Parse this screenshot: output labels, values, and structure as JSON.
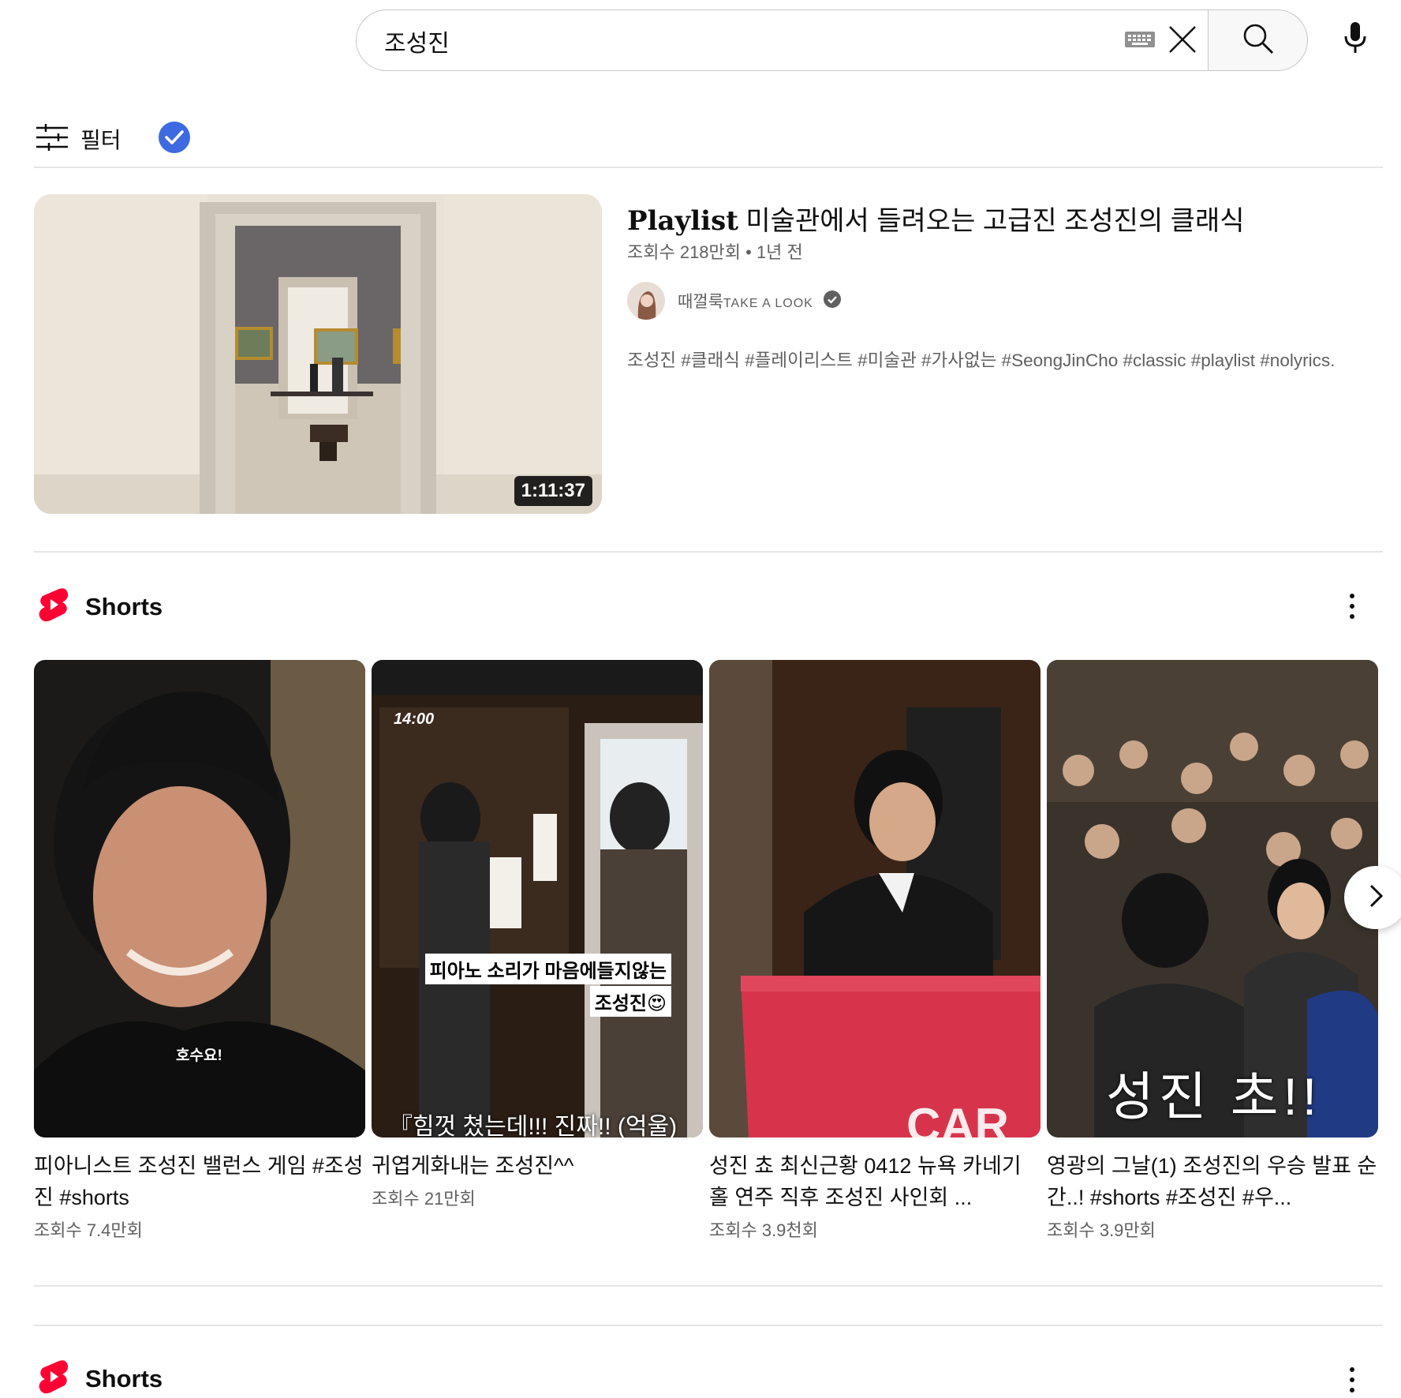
{
  "search": {
    "query": "조성진"
  },
  "filter": {
    "label": "필터"
  },
  "playlist": {
    "title_prefix": "Playlist",
    "title_rest": "미술관에서 들려오는 고급진 조성진의 클래식",
    "meta": "조회수 218만회 • 1년 전",
    "channel_name_main": "때껄룩",
    "channel_name_caps": "TAKE A LOOK",
    "description": "조성진 #클래식 #플레이리스트 #미술관 #가사없는 #SeongJinCho #classic #playlist #nolyrics.",
    "duration": "1:11:37"
  },
  "shorts_section": {
    "title": "Shorts",
    "items": [
      {
        "title": "피아니스트 조성진 밸런스 게임 #조성진 #shorts",
        "views": "조회수 7.4만회",
        "overlay": "호수요!"
      },
      {
        "title": "귀엽게화내는 조성진^^",
        "views": "조회수 21만회",
        "overlay_line1": "피아노 소리가 마음에들지않는",
        "overlay_line2": "조성진😍",
        "overlay_bottom": "『힘껏 쳤는데!!! 진짜!! (억울)",
        "overlay_top": "14:00"
      },
      {
        "title": "성진 쵸 최신근황 0412 뉴욕 카네기홀 연주 직후 조성진 사인회 ...",
        "views": "조회수 3.9천회",
        "overlay": "CAR"
      },
      {
        "title": "영광의 그날(1) 조성진의 우승 발표 순간..! #shorts #조성진 #우...",
        "views": "조회수 3.9만회",
        "overlay": "성진 초!!"
      }
    ]
  },
  "shorts_section_2": {
    "title": "Shorts"
  },
  "colors": {
    "accent_red": "#ff0033",
    "verified_blue": "#3e6ae1",
    "muted_text": "#606060"
  },
  "icons": [
    "keyboard-icon",
    "clear-icon",
    "search-icon",
    "mic-icon",
    "filter-icon",
    "check-icon",
    "verified-icon",
    "shorts-logo-icon",
    "more-icon",
    "chevron-right-icon"
  ]
}
